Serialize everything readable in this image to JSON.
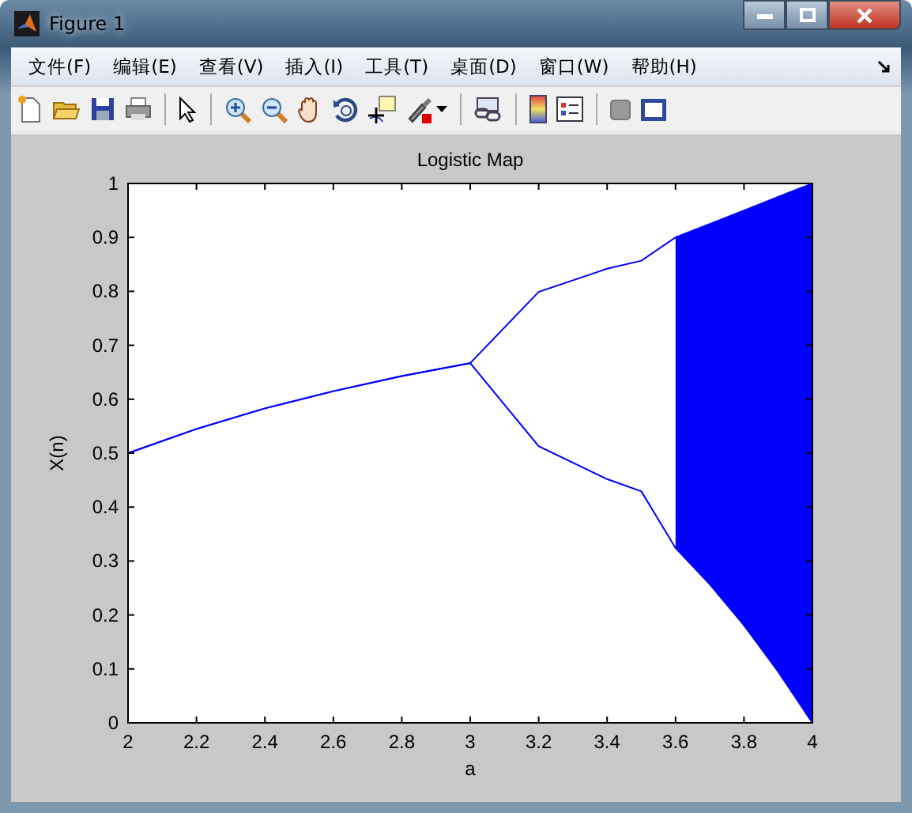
{
  "window": {
    "title": "Figure 1"
  },
  "menu": [
    "文件(F)",
    "编辑(E)",
    "查看(V)",
    "插入(I)",
    "工具(T)",
    "桌面(D)",
    "窗口(W)",
    "帮助(H)"
  ],
  "toolbar": [
    {
      "kind": "new"
    },
    {
      "kind": "open"
    },
    {
      "kind": "save"
    },
    {
      "kind": "print"
    },
    {
      "kind": "sep"
    },
    {
      "kind": "pointer"
    },
    {
      "kind": "sep"
    },
    {
      "kind": "zoom-in"
    },
    {
      "kind": "zoom-out"
    },
    {
      "kind": "hand"
    },
    {
      "kind": "rotate"
    },
    {
      "kind": "cursor"
    },
    {
      "kind": "brush"
    },
    {
      "kind": "sep"
    },
    {
      "kind": "link"
    },
    {
      "kind": "sep"
    },
    {
      "kind": "colorbar"
    },
    {
      "kind": "legend"
    },
    {
      "kind": "sep"
    },
    {
      "kind": "square"
    },
    {
      "kind": "frame"
    }
  ],
  "chart_data": {
    "type": "line",
    "title": "Logistic Map",
    "xlabel": "a",
    "ylabel": "X(n)",
    "x": [
      2,
      2.2,
      2.4,
      2.6,
      2.8,
      3,
      3.2,
      3.4,
      3.5,
      3.6,
      3.7,
      3.8,
      3.9,
      4
    ],
    "series": [
      {
        "color": "#0000ff",
        "values": [
          0.5,
          0.545,
          0.583,
          0.615,
          0.643,
          0.667,
          0.799,
          0.842,
          0.857,
          0.9,
          0.925,
          0.95,
          0.975,
          1
        ]
      },
      {
        "color": "#0000ff",
        "values": [
          0.5,
          0.545,
          0.583,
          0.615,
          0.643,
          0.667,
          0.513,
          0.452,
          0.429,
          0.324,
          0.257,
          0.181,
          0.095,
          0
        ]
      }
    ],
    "xlim": [
      2,
      4
    ],
    "ylim": [
      0,
      1
    ],
    "xticks": [
      {
        "value": 2,
        "label": "2"
      },
      {
        "value": 2.2,
        "label": "2.2"
      },
      {
        "value": 2.4,
        "label": "2.4"
      },
      {
        "value": 2.6,
        "label": "2.6"
      },
      {
        "value": 2.8,
        "label": "2.8"
      },
      {
        "value": 3,
        "label": "3"
      },
      {
        "value": 3.2,
        "label": "3.2"
      },
      {
        "value": 3.4,
        "label": "3.4"
      },
      {
        "value": 3.6,
        "label": "3.6"
      },
      {
        "value": 3.8,
        "label": "3.8"
      },
      {
        "value": 4,
        "label": "4"
      }
    ],
    "yticks": [
      {
        "value": 0,
        "label": "0"
      },
      {
        "value": 0.1,
        "label": "0.1"
      },
      {
        "value": 0.2,
        "label": "0.2"
      },
      {
        "value": 0.3,
        "label": "0.3"
      },
      {
        "value": 0.4,
        "label": "0.4"
      },
      {
        "value": 0.5,
        "label": "0.5"
      },
      {
        "value": 0.6,
        "label": "0.6"
      },
      {
        "value": 0.7,
        "label": "0.7"
      },
      {
        "value": 0.8,
        "label": "0.8"
      },
      {
        "value": 0.9,
        "label": "0.9"
      },
      {
        "value": 1,
        "label": "1"
      }
    ]
  }
}
